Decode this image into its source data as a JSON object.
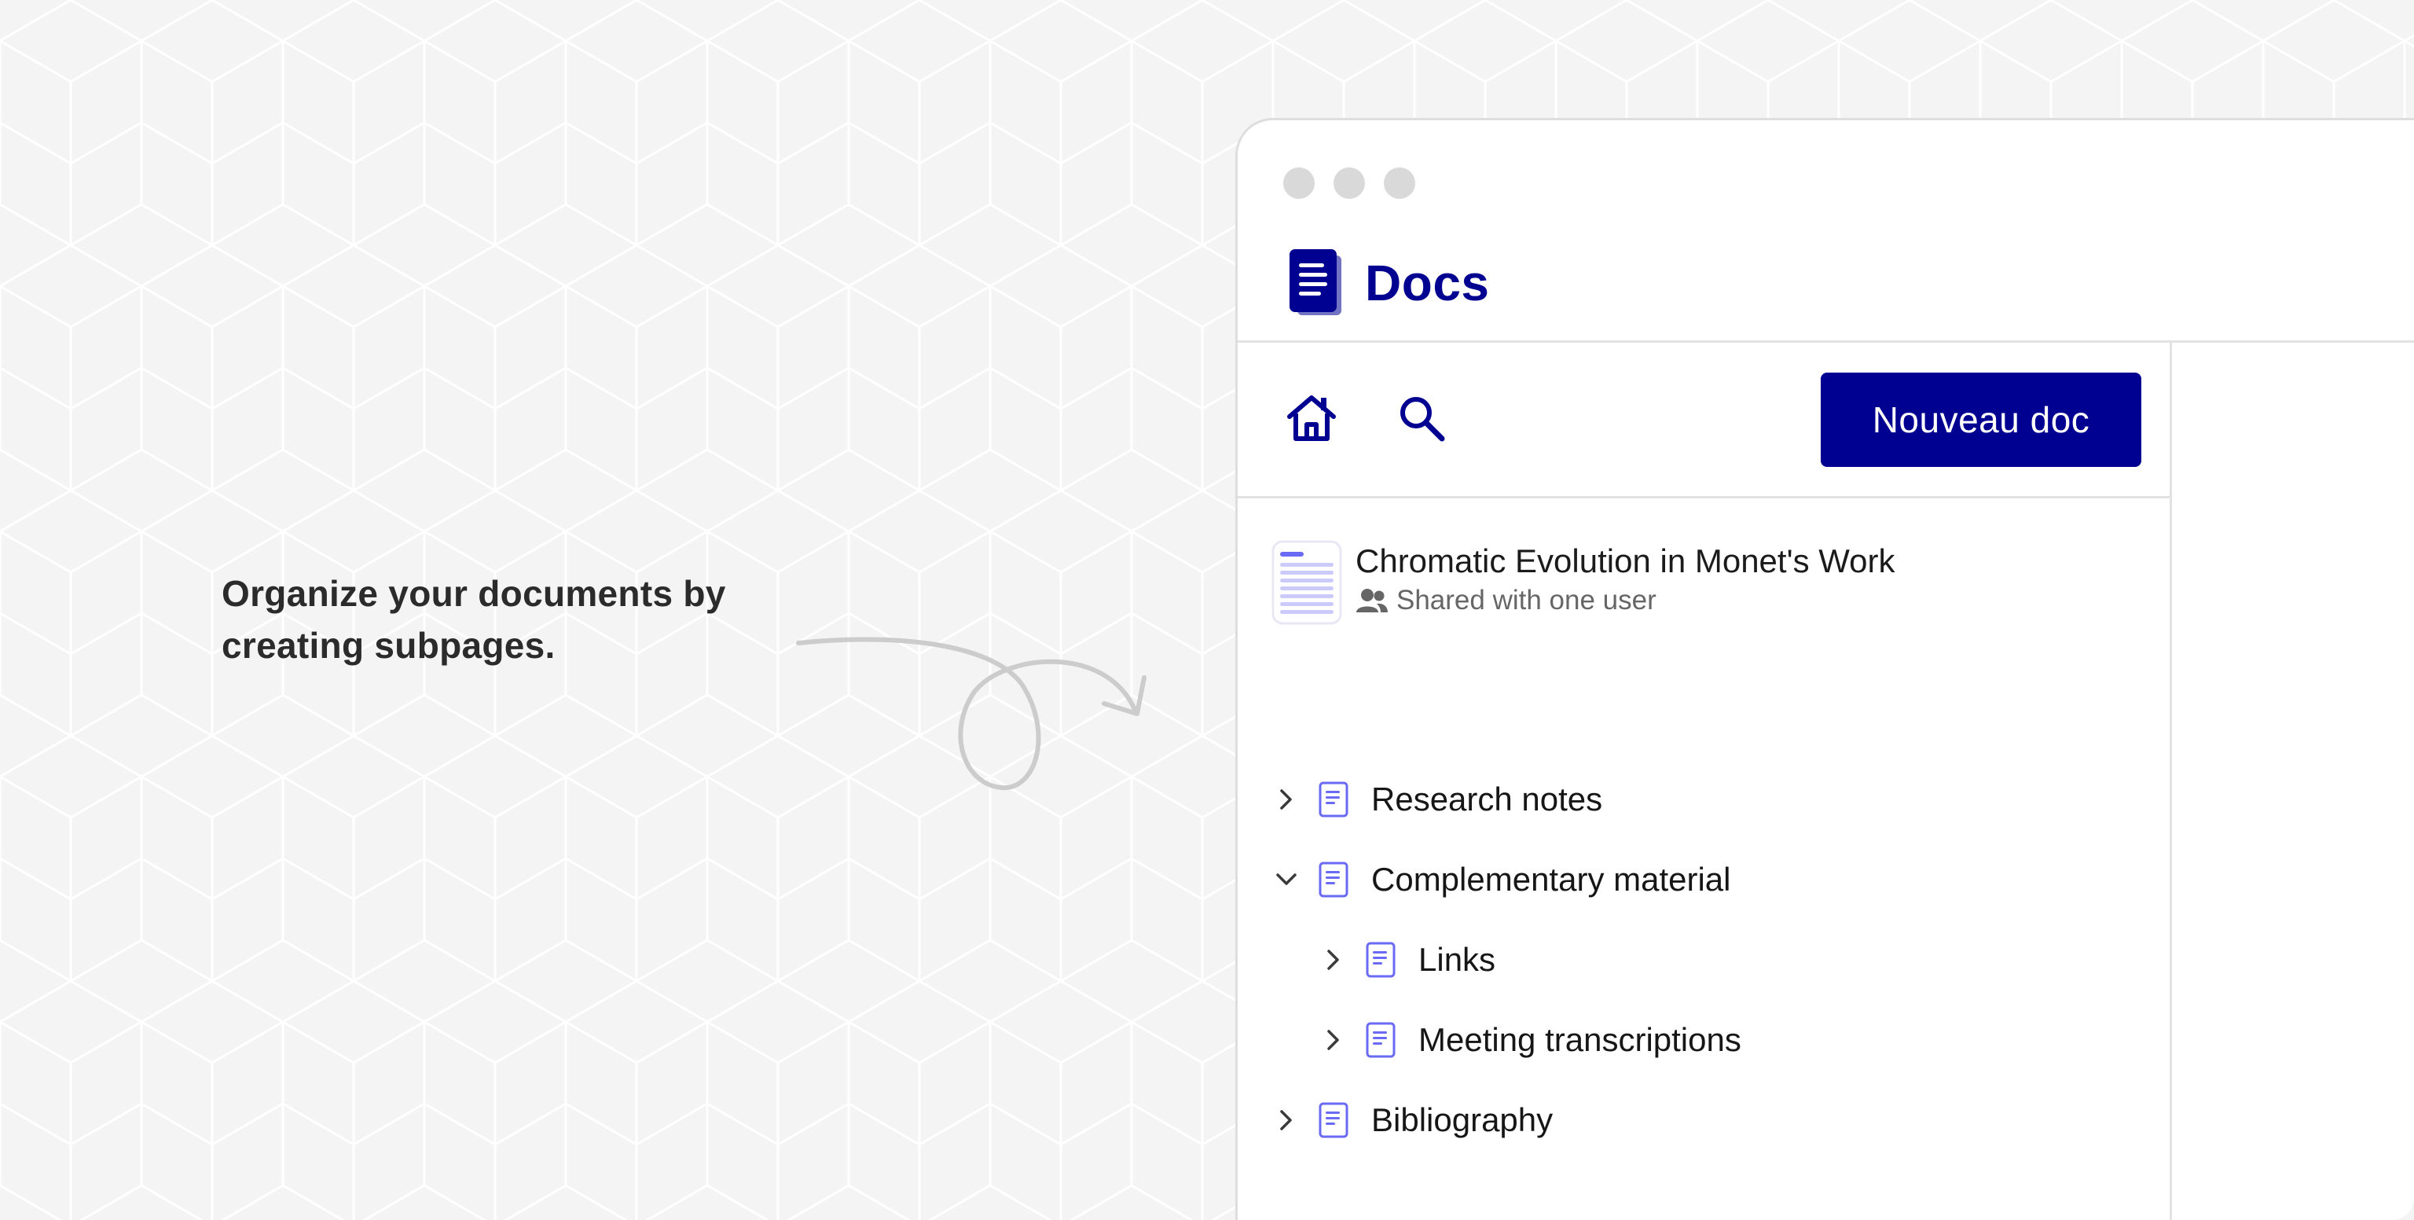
{
  "caption": {
    "line1": "Organize your documents by",
    "line2": "creating subpages."
  },
  "app": {
    "name": "Docs",
    "accent_color": "#000091"
  },
  "toolbar": {
    "home_icon": "home-icon",
    "search_icon": "search-icon",
    "new_doc_label": "Nouveau doc"
  },
  "document": {
    "title": "Chromatic Evolution in Monet's Work",
    "shared_text": "Shared with one user"
  },
  "tree": {
    "items": [
      {
        "label": "Research notes",
        "expanded": false,
        "level": 0
      },
      {
        "label": "Complementary material",
        "expanded": true,
        "level": 0
      },
      {
        "label": "Links",
        "expanded": false,
        "level": 1
      },
      {
        "label": "Meeting transcriptions",
        "expanded": false,
        "level": 1
      },
      {
        "label": "Bibliography",
        "expanded": false,
        "level": 0
      }
    ]
  }
}
